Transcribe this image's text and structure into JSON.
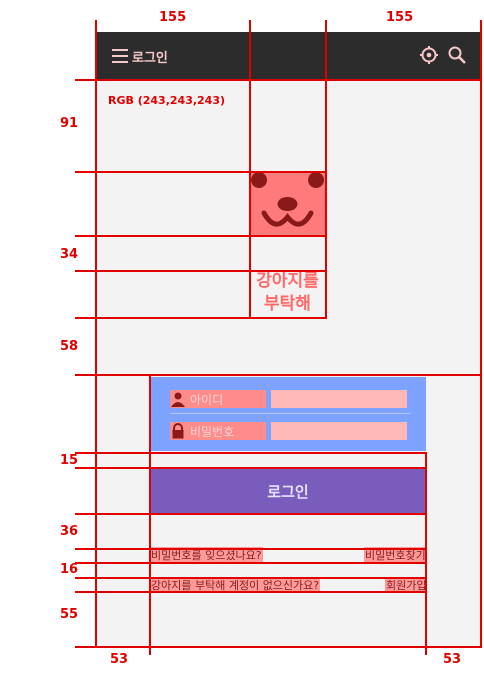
{
  "topbar": {
    "menu_label": "로그인",
    "icons": [
      "settings-icon",
      "search-icon"
    ]
  },
  "canvas_note": "RGB (243,243,243)",
  "brand": {
    "line1": "강아지를",
    "line2": "부탁해"
  },
  "form": {
    "id_label": "아이디",
    "password_label": "비밀번호",
    "login_button": "로그인"
  },
  "links": {
    "forgot_text": "비밀번호를 잊으셨나요?",
    "find_password": "비밀번호찾기",
    "no_account_text": "강아지를 부탁해 계정이 없으신가요?",
    "sign_up": "회원가입"
  },
  "measurements": {
    "top_left": "155",
    "top_right": "155",
    "left_91": "91",
    "left_34": "34",
    "left_58": "58",
    "left_15": "15",
    "left_36": "36",
    "left_16": "16",
    "left_55": "55",
    "bottom_left": "53",
    "bottom_right": "53"
  }
}
